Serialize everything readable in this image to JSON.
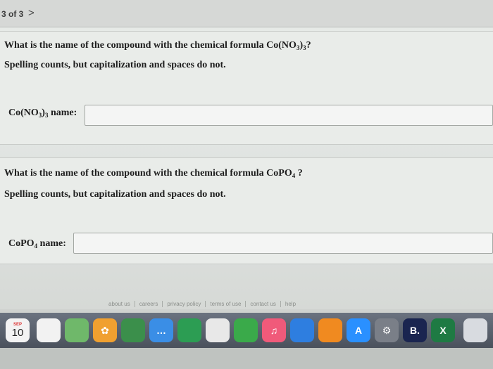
{
  "header": {
    "page_count": "3 of 3",
    "next_glyph": ">"
  },
  "question1": {
    "prompt_prefix": "What is the name of the compound with the chemical formula ",
    "formula_parts": {
      "a": "Co(NO",
      "s1": "3",
      "b": ")",
      "s2": "3"
    },
    "prompt_suffix": "?",
    "hint": "Spelling counts, but capitalization and spaces do not.",
    "label_suffix": " name:",
    "answer_value": ""
  },
  "question2": {
    "prompt_prefix": "What is the name of the compound with the chemical formula ",
    "formula_parts": {
      "a": "CoPO",
      "s1": "4"
    },
    "prompt_suffix": " ?",
    "hint": "Spelling counts, but capitalization and spaces do not.",
    "label_suffix": "  name:",
    "answer_value": ""
  },
  "footer": {
    "links": [
      "about us",
      "careers",
      "privacy policy",
      "terms of use",
      "contact us",
      "help"
    ]
  },
  "dock": {
    "calendar_month": "SEP",
    "calendar_day": "10",
    "apps": [
      {
        "name": "notes-icon",
        "glyph": "",
        "color": "#f2f2f2"
      },
      {
        "name": "maps-icon",
        "glyph": "",
        "color": "#6fb86a"
      },
      {
        "name": "photos-icon",
        "glyph": "✿",
        "color": "#f0a030"
      },
      {
        "name": "facetime-icon",
        "glyph": "",
        "color": "#3b8f4b"
      },
      {
        "name": "messages-icon",
        "glyph": "…",
        "color": "#3a8ee6"
      },
      {
        "name": "facetime-video-icon",
        "glyph": "",
        "color": "#2c9d53"
      },
      {
        "name": "news-icon",
        "glyph": "",
        "color": "#e8e8e8"
      },
      {
        "name": "numbers-icon",
        "glyph": "",
        "color": "#3aaa4a"
      },
      {
        "name": "music-icon",
        "glyph": "♫",
        "color": "#f05a7a"
      },
      {
        "name": "keynote-icon",
        "glyph": "",
        "color": "#2e7ee0"
      },
      {
        "name": "books-icon",
        "glyph": "",
        "color": "#f08a20"
      },
      {
        "name": "app-store-icon",
        "glyph": "A",
        "color": "#2a90ff"
      },
      {
        "name": "system-preferences-icon",
        "glyph": "⚙",
        "color": "#7a7f88"
      },
      {
        "name": "browser-icon",
        "glyph": "B.",
        "color": "#1a2550"
      },
      {
        "name": "excel-icon",
        "glyph": "X",
        "color": "#1e7a43"
      },
      {
        "name": "trash-icon",
        "glyph": "",
        "color": "#d8dbe0"
      }
    ]
  }
}
